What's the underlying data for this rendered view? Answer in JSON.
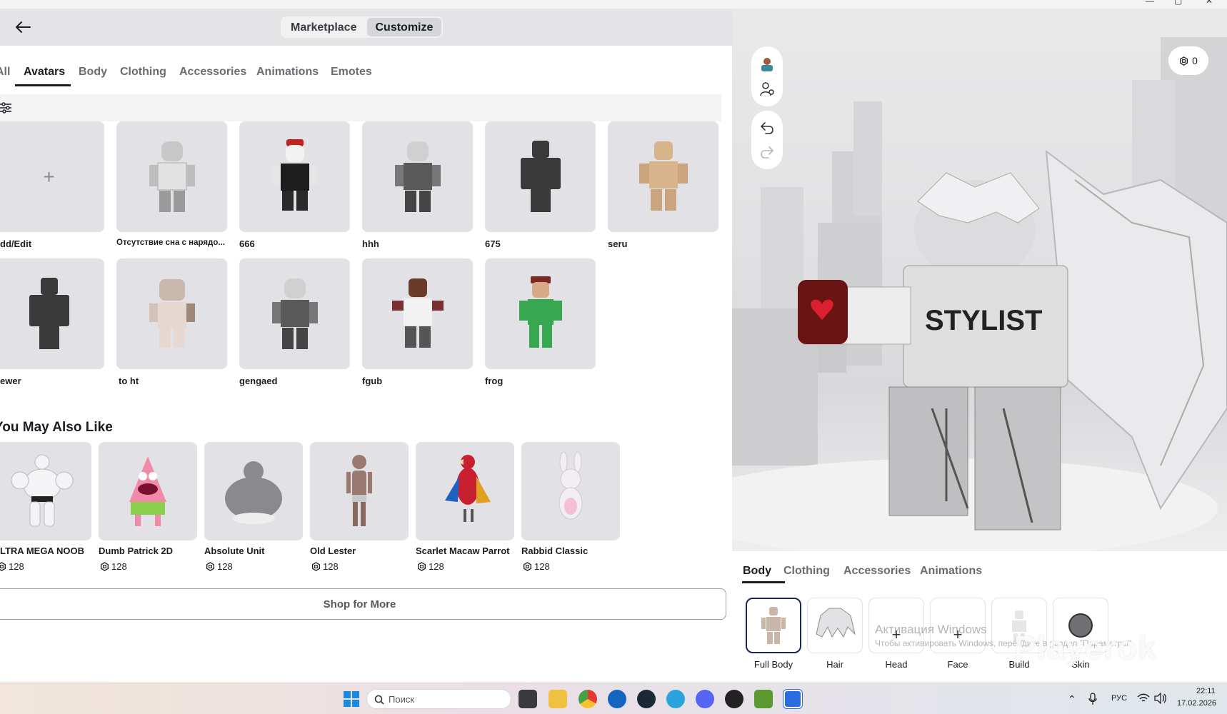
{
  "window": {
    "controls": [
      "—",
      "▢",
      "✕"
    ]
  },
  "header": {
    "segments": [
      {
        "label": "Marketplace",
        "active": false
      },
      {
        "label": "Customize",
        "active": true
      }
    ]
  },
  "tabs": [
    {
      "label": "All",
      "active": false
    },
    {
      "label": "Avatars",
      "active": true
    },
    {
      "label": "Body",
      "active": false
    },
    {
      "label": "Clothing",
      "active": false
    },
    {
      "label": "Accessories",
      "active": false
    },
    {
      "label": "Animations",
      "active": false
    },
    {
      "label": "Emotes",
      "active": false
    }
  ],
  "avatars": [
    {
      "label": "dd/Edit",
      "kind": "add"
    },
    {
      "label": "Отсутствие сна с нарядо...",
      "kind": "avatar",
      "color": "#d6d6d6"
    },
    {
      "label": "666",
      "kind": "avatar",
      "color": "#1e1e1e"
    },
    {
      "label": "hhh",
      "kind": "avatar",
      "color": "#4a4a4a"
    },
    {
      "label": "675",
      "kind": "avatar",
      "color": "#3a3a3a"
    },
    {
      "label": "seru",
      "kind": "avatar",
      "color": "#d8b48c"
    },
    {
      "label": "ewer",
      "kind": "avatar",
      "color": "#3a3a3a"
    },
    {
      "label": "to ht",
      "kind": "avatar",
      "color": "#d9c8be"
    },
    {
      "label": "gengaed",
      "kind": "avatar",
      "color": "#4a4a4a"
    },
    {
      "label": "fgub",
      "kind": "avatar",
      "color": "#7a3030"
    },
    {
      "label": "frog",
      "kind": "avatar",
      "color": "#38a850"
    }
  ],
  "recommendations": {
    "title": "You May Also Like",
    "items": [
      {
        "name": "LTRA MEGA NOOB",
        "price": "128",
        "color": "#f4f4f6"
      },
      {
        "name": "Dumb Patrick 2D",
        "price": "128",
        "color": "#f08aa8"
      },
      {
        "name": "Absolute Unit",
        "price": "128",
        "color": "#8a8a8e"
      },
      {
        "name": "Old Lester",
        "price": "128",
        "color": "#9a7a70"
      },
      {
        "name": "Scarlet Macaw Parrot",
        "price": "128",
        "color": "#c82030"
      },
      {
        "name": "Rabbid Classic",
        "price": "128",
        "color": "#f2eef4"
      }
    ],
    "shop_more": "Shop for More"
  },
  "viewport": {
    "balance": "0"
  },
  "editor": {
    "tabs": [
      {
        "label": "Body",
        "active": true
      },
      {
        "label": "Clothing",
        "active": false
      },
      {
        "label": "Accessories",
        "active": false
      },
      {
        "label": "Animations",
        "active": false
      }
    ],
    "slots": [
      {
        "label": "Full Body",
        "icon": "full-body-icon"
      },
      {
        "label": "Hair",
        "icon": "hair-icon"
      },
      {
        "label": "Head",
        "icon": "add-icon"
      },
      {
        "label": "Face",
        "icon": "add-icon"
      },
      {
        "label": "Build",
        "icon": "build-icon"
      },
      {
        "label": "Skin",
        "icon": "skin-color-icon"
      }
    ],
    "watermark_title": "Активация Windows",
    "watermark_sub": "Чтобы активировать Windows, перейдите в раздел \"Параметры\".",
    "brand": "Playerok"
  },
  "taskbar": {
    "search_placeholder": "Поиск",
    "lang": "РУС",
    "time": "22:11",
    "date": "17.02.2026"
  }
}
